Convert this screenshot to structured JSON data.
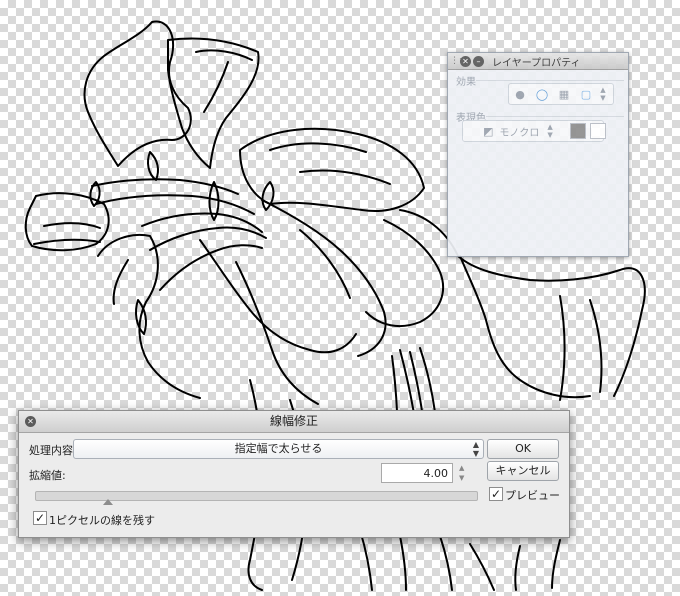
{
  "layer_panel": {
    "title": "レイヤープロパティ",
    "effect_label": "効果",
    "expression_label": "表現色",
    "expression_value": "モノクロ",
    "colors": {
      "black": "#8f8f8f",
      "white": "#ffffff"
    }
  },
  "dialog": {
    "title": "線幅修正",
    "process_label": "処理内容:",
    "process_value": "指定幅で太らせる",
    "amount_label": "拡縮値:",
    "amount_value": "4.00",
    "slider_value": 0.165,
    "one_pixel_label": "1ピクセルの線を残す",
    "one_pixel_checked": true,
    "ok_label": "OK",
    "cancel_label": "キャンセル",
    "preview_label": "プレビュー",
    "preview_checked": true
  }
}
